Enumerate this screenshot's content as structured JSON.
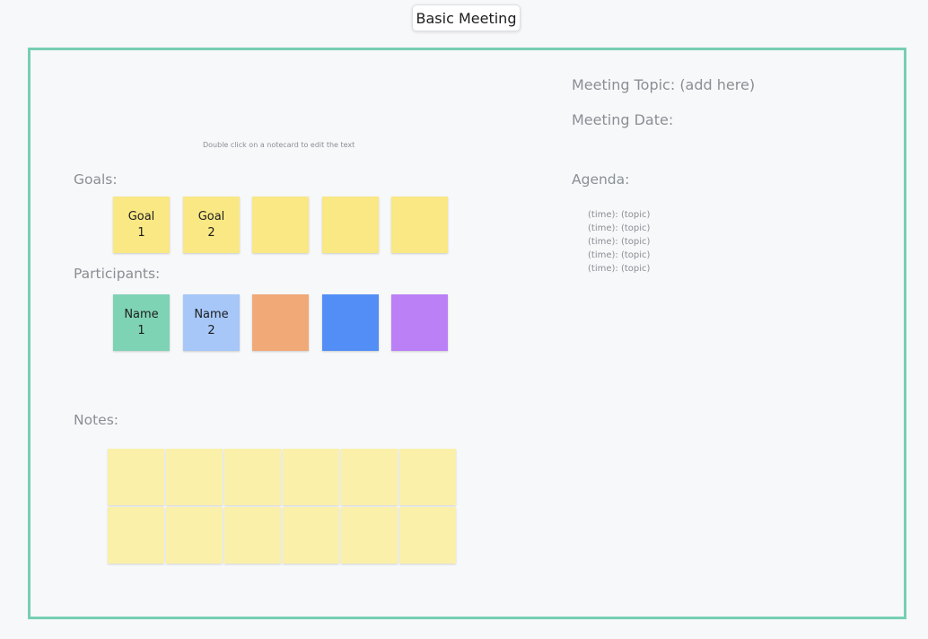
{
  "header": {
    "title": "Basic Meeting"
  },
  "board": {
    "hint": "Double click on a notecard to edit the text",
    "goals": {
      "label": "Goals:",
      "color": "#f9e883",
      "cards": [
        "Goal\n1",
        "Goal\n2",
        "",
        "",
        ""
      ]
    },
    "participants": {
      "label": "Participants:",
      "cards": [
        {
          "text": "Name\n1",
          "color": "#7fd3b5"
        },
        {
          "text": "Name\n2",
          "color": "#a6c7f8"
        },
        {
          "text": "",
          "color": "#f1a978"
        },
        {
          "text": "",
          "color": "#538ef6"
        },
        {
          "text": "",
          "color": "#bb80f6"
        }
      ]
    },
    "notes": {
      "label": "Notes:",
      "color": "#fbf0a9",
      "rows": 2,
      "cols": 6
    },
    "meeting_topic": "Meeting Topic: (add here)",
    "meeting_date": "Meeting Date:",
    "agenda": {
      "label": "Agenda:",
      "items": [
        "(time): (topic)",
        "(time): (topic)",
        "(time): (topic)",
        "(time): (topic)",
        "(time): (topic)"
      ]
    }
  },
  "colors": {
    "frame_border": "#76cfb2",
    "label_text": "#8a8f94"
  }
}
